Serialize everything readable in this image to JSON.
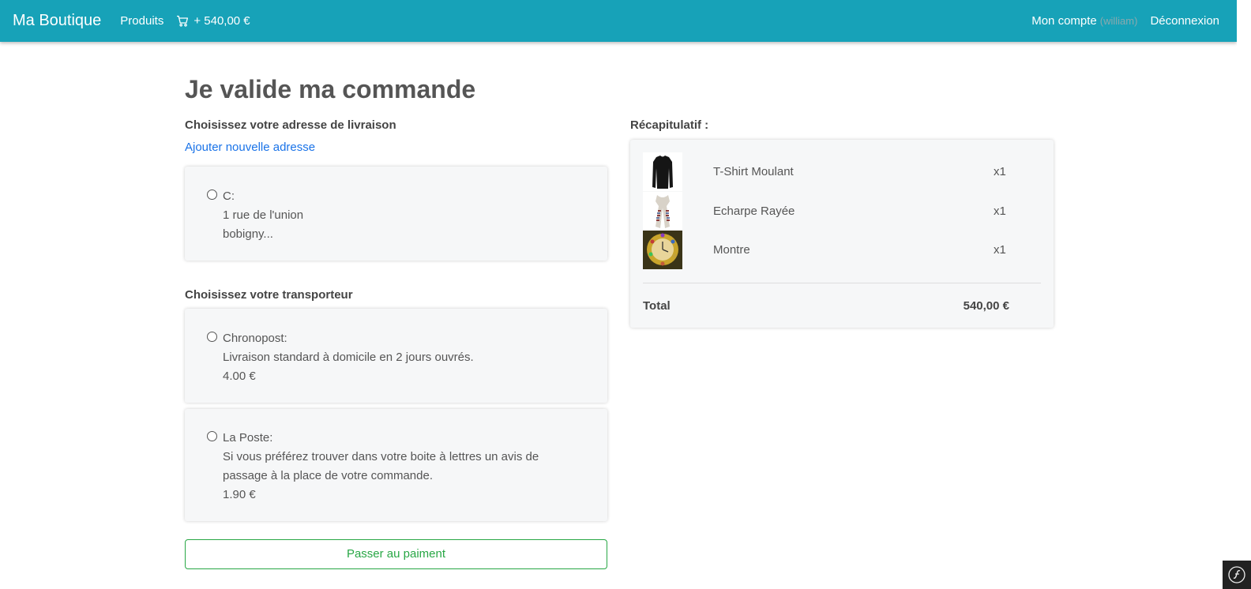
{
  "nav": {
    "brand": "Ma Boutique",
    "products": "Produits",
    "cart_label": "+ 540,00 €",
    "account": "Mon compte",
    "username": "(william)",
    "logout": "Déconnexion"
  },
  "page": {
    "title": "Je valide ma commande"
  },
  "address": {
    "section_title": "Choisissez votre adresse de livraison",
    "add_link": "Ajouter nouvelle adresse",
    "options": [
      {
        "name": "C:",
        "line1": "1 rue de l'union",
        "line2": "bobigny..."
      }
    ]
  },
  "carrier": {
    "section_title": "Choisissez votre transporteur",
    "options": [
      {
        "name": "Chronopost:",
        "description": "Livraison standard à domicile en 2 jours ouvrés.",
        "price": "4.00 €"
      },
      {
        "name": "La Poste:",
        "description": "Si vous préférez trouver dans votre boite à lettres un avis de passage à la place de votre commande.",
        "price": "1.90 €"
      }
    ]
  },
  "actions": {
    "submit": "Passer au paiment"
  },
  "summary": {
    "title": "Récapitulatif :",
    "items": [
      {
        "name": "T-Shirt Moulant",
        "qty": "x1",
        "image": "tshirt"
      },
      {
        "name": "Echarpe Rayée",
        "qty": "x1",
        "image": "scarf"
      },
      {
        "name": "Montre",
        "qty": "x1",
        "image": "watch"
      }
    ],
    "total_label": "Total",
    "total_value": "540,00 €"
  },
  "icons": {
    "cart": "cart-icon",
    "radio": "radio-icon",
    "debug": "symfony-icon"
  },
  "colors": {
    "navbar": "#17a2b8",
    "link": "#1a73e8",
    "button": "#28a745"
  }
}
